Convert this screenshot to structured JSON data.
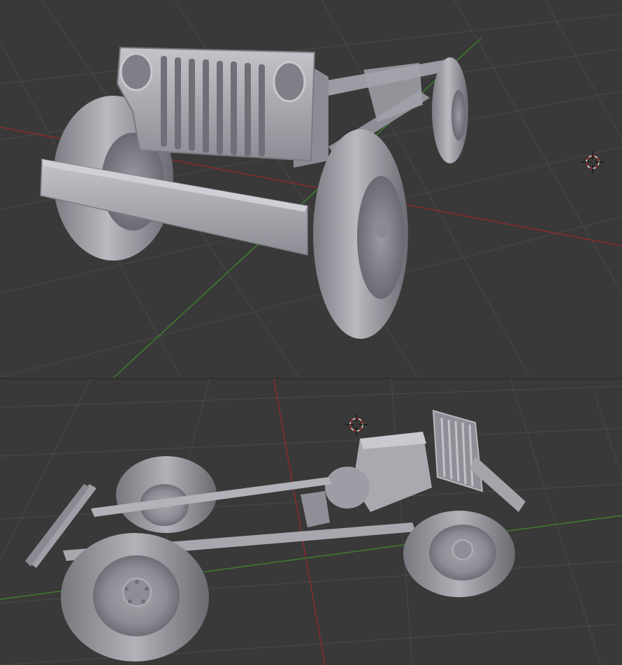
{
  "viewports": [
    {
      "id": "top",
      "view": "perspective",
      "object": "jeep-chassis"
    },
    {
      "id": "bottom",
      "view": "perspective",
      "object": "jeep-chassis"
    }
  ],
  "colors": {
    "background": "#393939",
    "grid": "#4a4a4a",
    "x_axis": "#8a2c2c",
    "y_axis": "#3f7d2e",
    "model": "#a9a9b1",
    "model_shadow": "#6e6e75",
    "model_highlight": "#d6d6dc"
  },
  "icons": [
    "3d-cursor-icon"
  ]
}
